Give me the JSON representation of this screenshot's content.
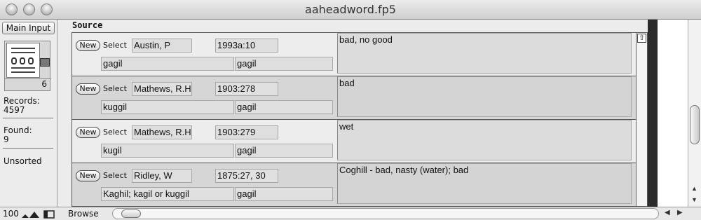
{
  "window": {
    "title": "aaheadword.fp5"
  },
  "status": {
    "layout_button": "Main Input",
    "record_number": "6",
    "records_label": "Records:",
    "records_value": "4597",
    "found_label": "Found:",
    "found_value": "9",
    "sort_state": "Unsorted"
  },
  "portal": {
    "section_label": "Source",
    "rows": [
      {
        "new_label": "New",
        "select_label": "Select",
        "source": "Austin, P",
        "date": "1993a:10",
        "form": "gagil",
        "headword": "gagil",
        "gloss": "bad, no good"
      },
      {
        "new_label": "New",
        "select_label": "Select",
        "source": "Mathews, R.H.",
        "date": "1903:278",
        "form": "kuggil",
        "headword": "gagil",
        "gloss": "bad"
      },
      {
        "new_label": "New",
        "select_label": "Select",
        "source": "Mathews, R.H.",
        "date": "1903:279",
        "form": "kugil",
        "headword": "gagil",
        "gloss": "wet"
      },
      {
        "new_label": "New",
        "select_label": "Select",
        "source": "Ridley, W",
        "date": "1875:27, 30",
        "form": "Kaghil; kagil or kuggil",
        "headword": "gagil",
        "gloss": "Coghill - bad, nasty (water); bad"
      }
    ]
  },
  "footer": {
    "zoom": "100",
    "mode": "Browse"
  },
  "icons": {
    "traffic_lights": [
      "close-icon",
      "minimize-icon",
      "zoom-icon"
    ],
    "book": "book-icon",
    "portal_up": "up-arrow-icon"
  }
}
